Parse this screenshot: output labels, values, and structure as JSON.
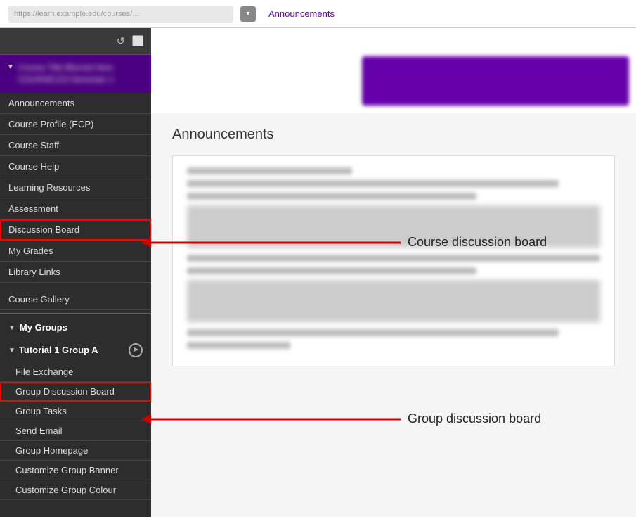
{
  "topbar": {
    "url_placeholder": "https://learn.example.edu/courses/...",
    "dropdown_icon": "▾",
    "link_text": "Announcements"
  },
  "sidebar": {
    "toolbar_icons": [
      "↺",
      "⬜"
    ],
    "course_title_blurred": "Course Name Blurred",
    "nav_items": [
      {
        "label": "Announcements",
        "id": "announcements"
      },
      {
        "label": "Course Profile (ECP)",
        "id": "course-profile"
      },
      {
        "label": "Course Staff",
        "id": "course-staff"
      },
      {
        "label": "Course Help",
        "id": "course-help"
      },
      {
        "label": "Learning Resources",
        "id": "learning-resources"
      },
      {
        "label": "Assessment",
        "id": "assessment"
      },
      {
        "label": "Discussion Board",
        "id": "discussion-board",
        "highlighted": true
      },
      {
        "label": "My Grades",
        "id": "my-grades"
      },
      {
        "label": "Library Links",
        "id": "library-links"
      }
    ],
    "extra_items": [
      {
        "label": "Course Gallery",
        "id": "course-gallery"
      }
    ],
    "my_groups_label": "My Groups",
    "group_name": "Tutorial 1 Group A",
    "group_items": [
      {
        "label": "File Exchange",
        "id": "file-exchange"
      },
      {
        "label": "Group Discussion Board",
        "id": "group-discussion-board",
        "highlighted": true
      },
      {
        "label": "Group Tasks",
        "id": "group-tasks"
      },
      {
        "label": "Send Email",
        "id": "send-email"
      },
      {
        "label": "Group Homepage",
        "id": "group-homepage"
      },
      {
        "label": "Customize Group Banner",
        "id": "customize-group-banner"
      },
      {
        "label": "Customize Group Colour",
        "id": "customize-group-colour"
      }
    ]
  },
  "content": {
    "title": "Announcements",
    "annotation_course": "Course discussion board",
    "annotation_group": "Group discussion board"
  }
}
